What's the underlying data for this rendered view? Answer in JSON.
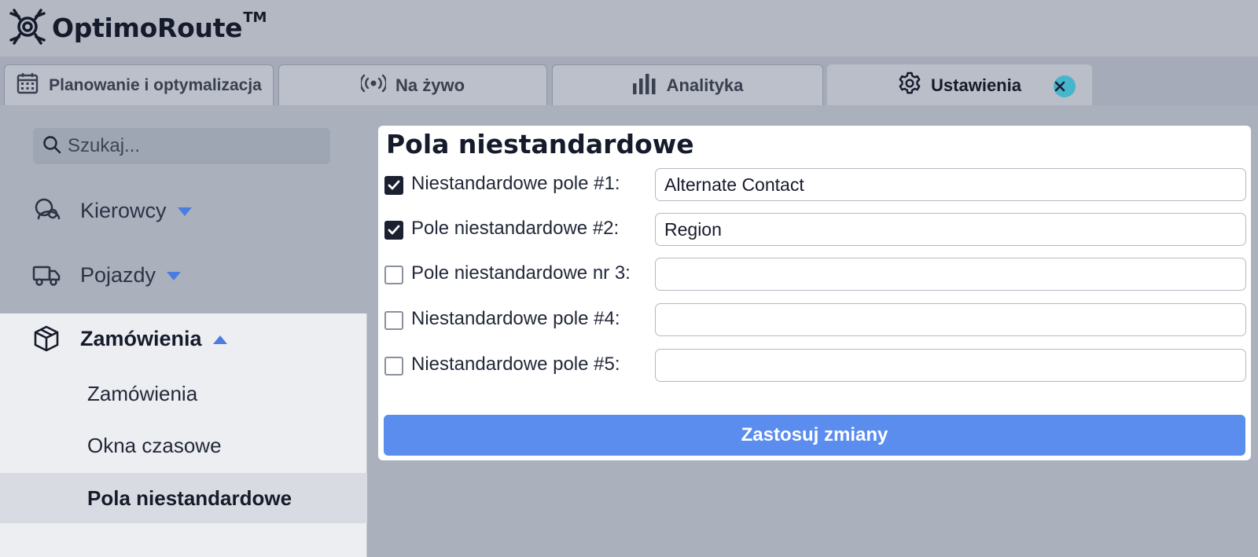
{
  "app": {
    "name": "OptimoRoute",
    "trademark": "TM"
  },
  "tabs": [
    {
      "label": "Planowanie i optymalizacja",
      "icon": "calendar-icon"
    },
    {
      "label": "Na żywo",
      "icon": "live-broadcast-icon"
    },
    {
      "label": "Analityka",
      "icon": "bar-chart-icon"
    },
    {
      "label": "Ustawienia",
      "icon": "gear-icon",
      "active": true
    }
  ],
  "sidebar": {
    "search": {
      "placeholder": "Szukaj..."
    },
    "items": [
      {
        "label": "Kierowcy",
        "icon": "driver-icon",
        "expanded": false
      },
      {
        "label": "Pojazdy",
        "icon": "truck-icon",
        "expanded": false
      },
      {
        "label": "Zamówienia",
        "icon": "package-icon",
        "expanded": true
      }
    ],
    "subitems": [
      {
        "label": "Zamówienia"
      },
      {
        "label": "Okna czasowe"
      },
      {
        "label": "Pola niestandardowe",
        "active": true
      }
    ]
  },
  "panel": {
    "title": "Pola niestandardowe",
    "fields": [
      {
        "label": "Niestandardowe pole #1:",
        "checked": true,
        "value": "Alternate Contact"
      },
      {
        "label": "Pole niestandardowe #2:",
        "checked": true,
        "value": "Region"
      },
      {
        "label": "Pole niestandardowe nr 3:",
        "checked": false,
        "value": ""
      },
      {
        "label": "Niestandardowe pole #4:",
        "checked": false,
        "value": ""
      },
      {
        "label": "Niestandardowe pole #5:",
        "checked": false,
        "value": ""
      }
    ],
    "apply_label": "Zastosuj zmiany"
  },
  "colors": {
    "accent": "#5b8def",
    "caret": "#4a7de0",
    "close_button": "#47b5cc",
    "checkbox_checked": "#1b2130"
  }
}
